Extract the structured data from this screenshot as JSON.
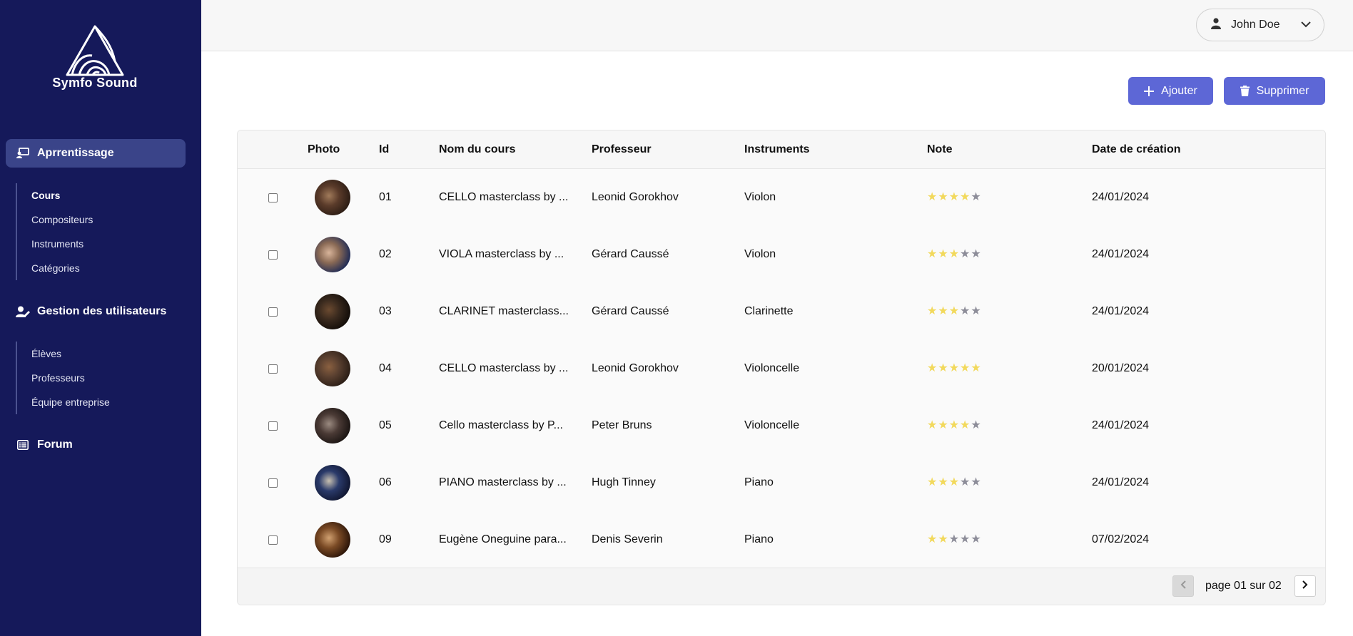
{
  "app": {
    "brand": "Symfo Sound"
  },
  "sidebar": {
    "sections": [
      {
        "label": "Aprrentissage",
        "icon": "chalkboard-teacher-icon",
        "active": true,
        "items": [
          {
            "label": "Cours",
            "active": true
          },
          {
            "label": "Compositeurs"
          },
          {
            "label": "Instruments"
          },
          {
            "label": "Catégories"
          }
        ]
      },
      {
        "label": "Gestion des utilisateurs",
        "icon": "user-edit-icon",
        "items": [
          {
            "label": "Élèves"
          },
          {
            "label": "Professeurs"
          },
          {
            "label": "Équipe entreprise"
          }
        ]
      },
      {
        "label": "Forum",
        "icon": "list-icon",
        "items": []
      }
    ]
  },
  "header": {
    "user_name": "John Doe"
  },
  "actions": {
    "add_label": "Ajouter",
    "delete_label": "Supprimer"
  },
  "colors": {
    "sidebar": "#15195a",
    "accent": "#5d67d6",
    "active_nav": "#3a4489",
    "star_on": "#f2d95c",
    "star_off": "#8d8d99"
  },
  "table": {
    "columns": [
      "",
      "Photo",
      "Id",
      "Nom du cours",
      "Professeur",
      "Instruments",
      "Note",
      "Date de création"
    ],
    "rows": [
      {
        "id": "01",
        "course": "CELLO masterclass by ...",
        "teacher": "Leonid Gorokhov",
        "instrument": "Violon",
        "rating": 4,
        "date": "24/01/2024"
      },
      {
        "id": "02",
        "course": "VIOLA masterclass by ...",
        "teacher": "Gérard Caussé",
        "instrument": "Violon",
        "rating": 3,
        "date": "24/01/2024"
      },
      {
        "id": "03",
        "course": "CLARINET masterclass...",
        "teacher": "Gérard Caussé",
        "instrument": "Clarinette",
        "rating": 3,
        "date": "24/01/2024"
      },
      {
        "id": "04",
        "course": "CELLO masterclass by ...",
        "teacher": "Leonid Gorokhov",
        "instrument": "Violoncelle",
        "rating": 5,
        "date": "20/01/2024"
      },
      {
        "id": "05",
        "course": "Cello masterclass by P...",
        "teacher": "Peter Bruns",
        "instrument": "Violoncelle",
        "rating": 4,
        "date": "24/01/2024"
      },
      {
        "id": "06",
        "course": "PIANO masterclass by ...",
        "teacher": "Hugh Tinney",
        "instrument": "Piano",
        "rating": 3,
        "date": "24/01/2024"
      },
      {
        "id": "09",
        "course": "Eugène Oneguine para...",
        "teacher": "Denis Severin",
        "instrument": "Piano",
        "rating": 2,
        "date": "07/02/2024"
      }
    ]
  },
  "pagination": {
    "label": "page 01 sur 02"
  }
}
